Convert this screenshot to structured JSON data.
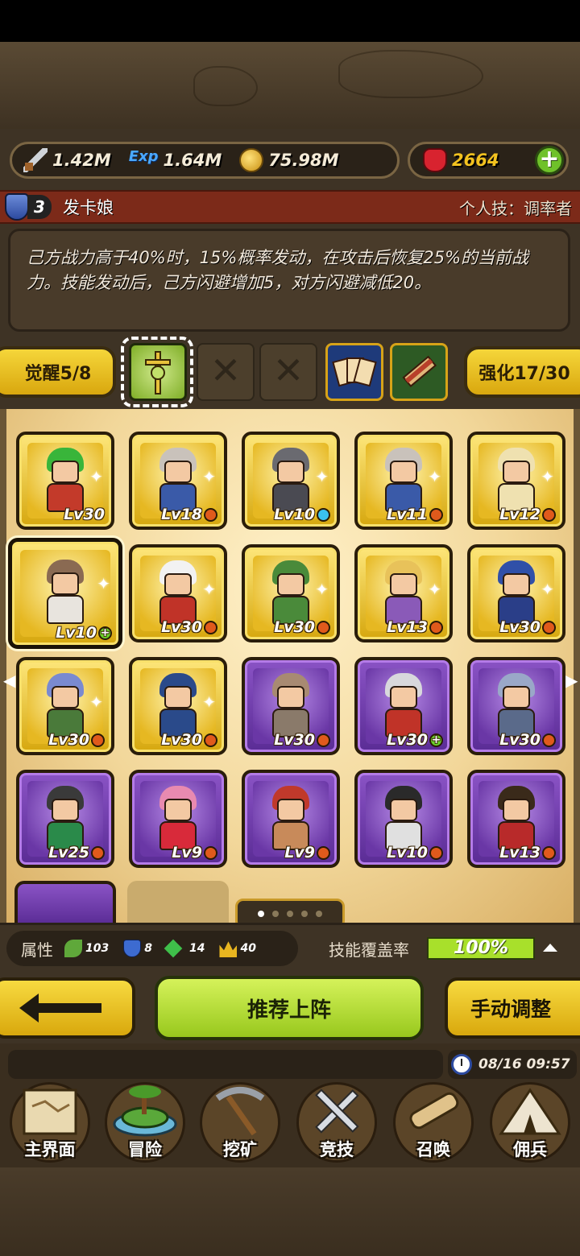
{
  "resources": {
    "power": "1.42M",
    "exp_icon": "Exp",
    "exp": "1.64M",
    "gold": "75.98M",
    "gems": "2664",
    "add": "+"
  },
  "hero": {
    "rank": "3",
    "name": "发卡娘",
    "skill": "个人技：调率者",
    "description": "己方战力高于40%时，15%概率发动，在攻击后恢复25%的当前战力。技能发动后，己方闪避增加5，对方闪避减低20。"
  },
  "skills": {
    "awaken": "觉醒5/8",
    "enhance": "强化17/30",
    "empty_mark": "✕"
  },
  "roster": [
    {
      "lv": "Lv30",
      "frame": "gold",
      "badge": "",
      "hair": "#39b53a",
      "body": "#c33a2a"
    },
    {
      "lv": "Lv18",
      "frame": "gold",
      "badge": "red",
      "hair": "#c9c2bb",
      "body": "#3a5aa8"
    },
    {
      "lv": "Lv10",
      "frame": "gold",
      "badge": "blue",
      "hair": "#6a6a70",
      "body": "#4a4a52"
    },
    {
      "lv": "Lv11",
      "frame": "gold",
      "badge": "red",
      "hair": "#c9c2bb",
      "body": "#3a5aa8"
    },
    {
      "lv": "Lv12",
      "frame": "gold",
      "badge": "red",
      "hair": "#efe1b0",
      "body": "#efe1b0"
    },
    {
      "lv": "Lv10",
      "frame": "gold",
      "badge": "green",
      "hair": "#8a6a52",
      "body": "#e8e4de"
    },
    {
      "lv": "Lv30",
      "frame": "gold",
      "badge": "red",
      "hair": "#f2f2f2",
      "body": "#c03328"
    },
    {
      "lv": "Lv30",
      "frame": "gold",
      "badge": "red",
      "hair": "#4a8a3a",
      "body": "#4a8a3a"
    },
    {
      "lv": "Lv13",
      "frame": "gold",
      "badge": "red",
      "hair": "#e8c25a",
      "body": "#8a5ab8"
    },
    {
      "lv": "Lv30",
      "frame": "gold",
      "badge": "red",
      "hair": "#3050a8",
      "body": "#2a3e88"
    },
    {
      "lv": "Lv30",
      "frame": "gold",
      "badge": "red",
      "hair": "#7a8ad0",
      "body": "#4a7a3a"
    },
    {
      "lv": "Lv30",
      "frame": "gold",
      "badge": "red",
      "hair": "#2a4a8a",
      "body": "#2a4a8a"
    },
    {
      "lv": "Lv30",
      "frame": "purple",
      "badge": "red",
      "hair": "#a88a72",
      "body": "#8a7a6a"
    },
    {
      "lv": "Lv30",
      "frame": "purple",
      "badge": "green",
      "hair": "#d8d8dc",
      "body": "#c03328"
    },
    {
      "lv": "Lv30",
      "frame": "purple",
      "badge": "red",
      "hair": "#9aa8c8",
      "body": "#5a6a8a"
    },
    {
      "lv": "Lv25",
      "frame": "purple",
      "badge": "red",
      "hair": "#3a3a3a",
      "body": "#2a8a4a"
    },
    {
      "lv": "Lv9",
      "frame": "purple",
      "badge": "red",
      "hair": "#e88ab0",
      "body": "#d82a3a"
    },
    {
      "lv": "Lv9",
      "frame": "purple",
      "badge": "red",
      "hair": "#c0392b",
      "body": "#c88a5a"
    },
    {
      "lv": "Lv10",
      "frame": "purple",
      "badge": "red",
      "hair": "#2a2a2a",
      "body": "#e0e0e0"
    },
    {
      "lv": "Lv13",
      "frame": "purple",
      "badge": "red",
      "hair": "#3a2a1a",
      "body": "#b82a2a"
    }
  ],
  "attributes": {
    "label": "属性",
    "leaf": "103",
    "shield": "8",
    "gem": "14",
    "crown": "40",
    "coverage_label": "技能覆盖率",
    "coverage": "100%"
  },
  "actions": {
    "recommend": "推荐上阵",
    "manual": "手动调整"
  },
  "status": {
    "time": "08/16 09:57"
  },
  "nav": [
    {
      "label": "主界面",
      "icon": "map-scroll-icon"
    },
    {
      "label": "冒险",
      "icon": "island-icon"
    },
    {
      "label": "挖矿",
      "icon": "pickaxe-icon"
    },
    {
      "label": "竞技",
      "icon": "crossed-swords-icon"
    },
    {
      "label": "召唤",
      "icon": "summon-scroll-icon"
    },
    {
      "label": "佣兵",
      "icon": "tent-icon"
    }
  ]
}
